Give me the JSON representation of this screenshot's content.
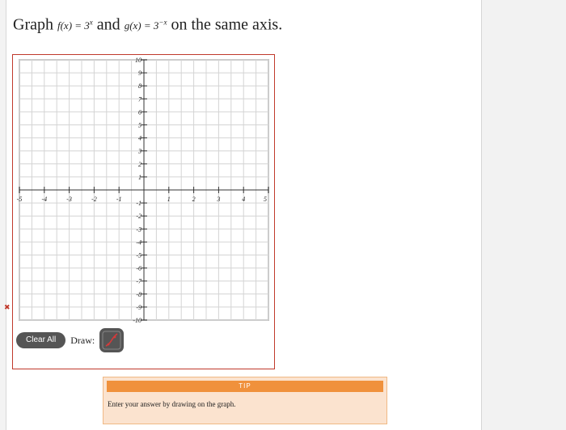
{
  "question": {
    "prefix": "Graph",
    "f": "f(x) = 3",
    "f_exp": "x",
    "and": "and",
    "g": "g(x) = 3",
    "g_exp": "−x",
    "suffix": "on the same axis."
  },
  "graph": {
    "x_ticks": [
      "-5",
      "-4",
      "-3",
      "-2",
      "-1",
      "1",
      "2",
      "3",
      "4",
      "5"
    ],
    "y_ticks_pos": [
      "10",
      "9",
      "8",
      "7",
      "6",
      "5",
      "4",
      "3",
      "2",
      "1"
    ],
    "y_ticks_neg": [
      "-1",
      "-2",
      "-3",
      "-4",
      "-5",
      "-6",
      "-7",
      "-8",
      "-9",
      "-10"
    ],
    "xlim": [
      -5,
      5
    ],
    "ylim": [
      -10,
      10
    ],
    "grid": true
  },
  "controls": {
    "clear_label": "Clear All",
    "draw_label": "Draw:",
    "draw_tool_icon": "curve-draw-icon"
  },
  "status": {
    "error_mark": "✖"
  },
  "tip": {
    "heading": "TIP",
    "text": "Enter your answer by drawing on the graph."
  },
  "colors": {
    "frame": "#c0392b",
    "tip_head": "#f0913c",
    "tip_bg": "#fbe3cf",
    "button": "#555555"
  }
}
